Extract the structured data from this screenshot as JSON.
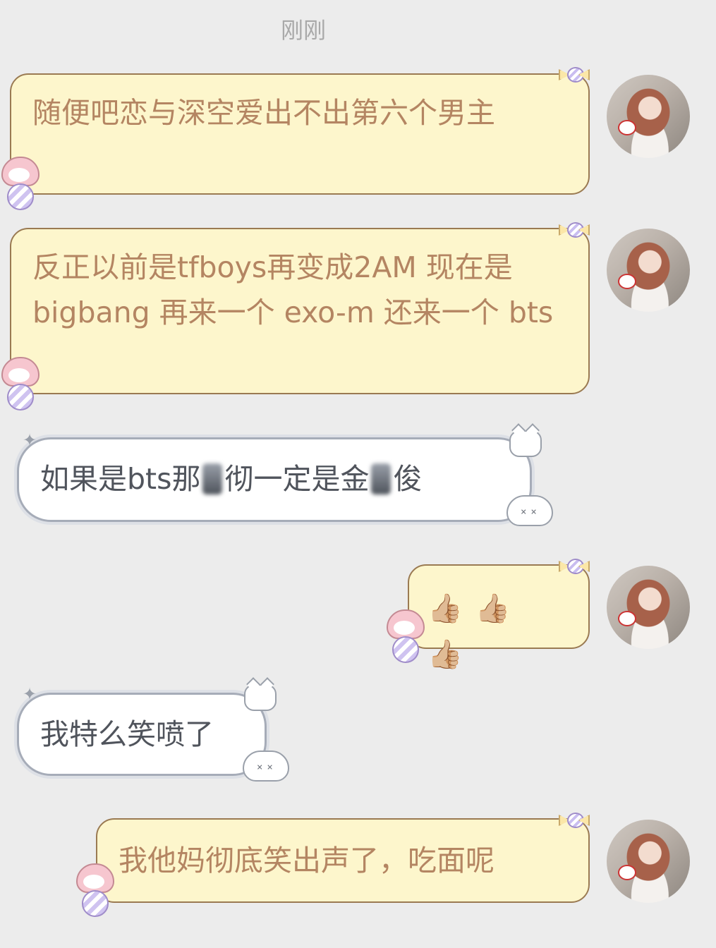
{
  "timestamp": "刚刚",
  "messages": [
    {
      "side": "sent",
      "text": "随便吧恋与深空爱出不出第六个男主"
    },
    {
      "side": "sent",
      "text": "反正以前是tfboys再变成2AM 现在是bigbang 再来一个 exo-m 还来一个 bts"
    },
    {
      "side": "received",
      "text_before": "如果是bts那",
      "text_middle": "彻一定是金",
      "text_after": "俊"
    },
    {
      "side": "sent",
      "text": "👍🏼👍🏼👍🏼"
    },
    {
      "side": "received",
      "text": "我特么笑喷了"
    },
    {
      "side": "sent",
      "text": "我他妈彻底笑出声了，吃面呢"
    }
  ],
  "icons": {
    "avatar": "user-avatar-photo",
    "sticker_left": "my-melody-candy-sticker",
    "sticker_right": "candy-sticker",
    "sticker_cloud": "cloud-character-sticker",
    "sticker_kitty": "kitty-sticker",
    "sparkle": "sparkle-icon"
  },
  "colors": {
    "background": "#ececec",
    "sent_bubble": "#fdf6cc",
    "sent_text": "#b48562",
    "received_bubble": "#ffffff",
    "received_text": "#50545c"
  }
}
